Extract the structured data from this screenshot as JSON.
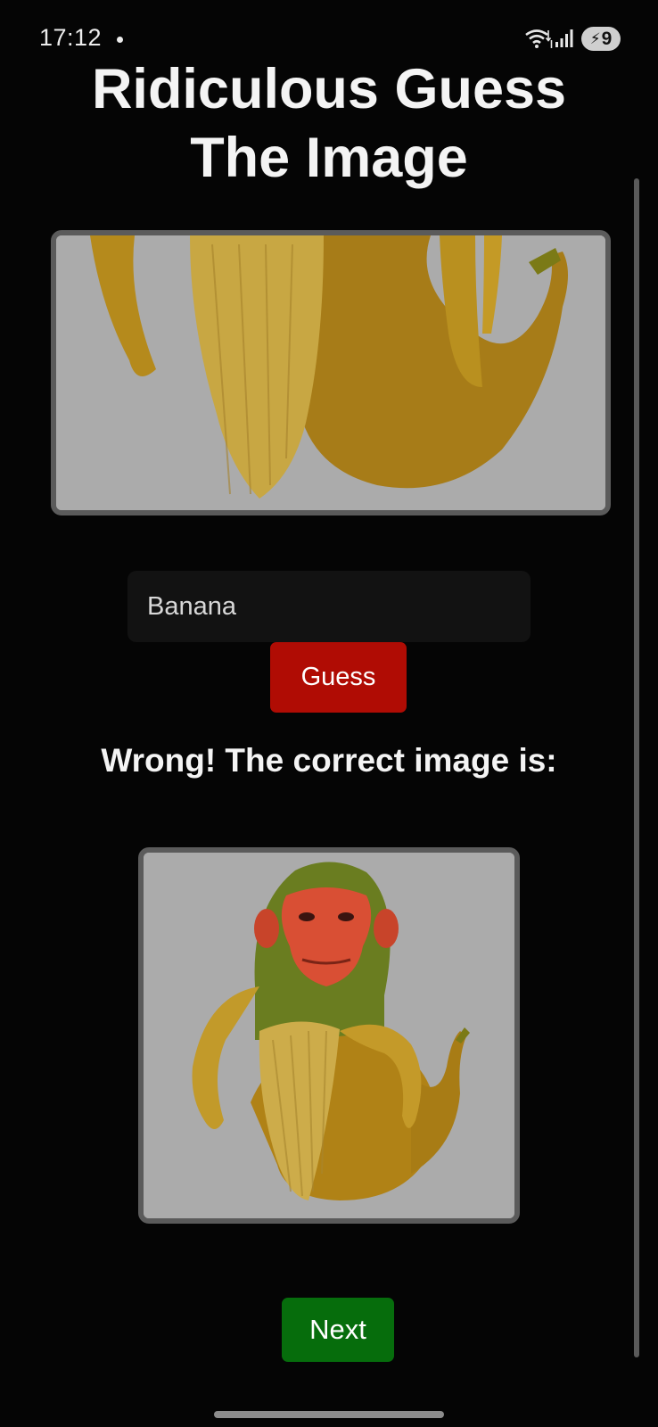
{
  "status_bar": {
    "time": "17:12",
    "battery_level": "9",
    "icons": [
      "notification-dot",
      "wifi-icon",
      "signal-icon",
      "battery-charging-icon"
    ]
  },
  "app": {
    "title_line1": "Ridiculous Guess",
    "title_line2": "The Image"
  },
  "quiz": {
    "guess_value": "Banana",
    "guess_button_label": "Guess",
    "result_text": "Wrong! The correct image is:",
    "next_button_label": "Next"
  },
  "colors": {
    "background": "#050505",
    "guess_button": "#b00c04",
    "next_button": "#066d0c",
    "frame_border": "#5b5b5b",
    "image_background": "#ababab"
  }
}
